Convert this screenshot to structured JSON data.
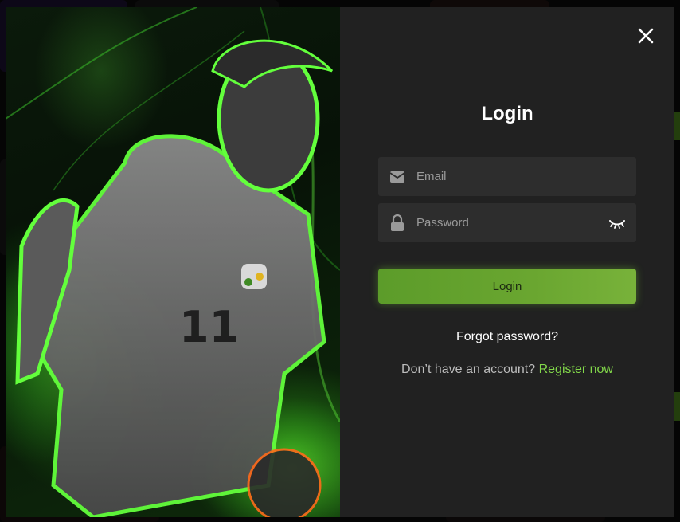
{
  "login": {
    "title": "Login",
    "email_placeholder": "Email",
    "password_placeholder": "Password",
    "submit_label": "Login",
    "forgot_label": "Forgot password?",
    "no_account_text": "Don’t have an account? ",
    "register_label": "Register now"
  },
  "icons": {
    "close": "close-icon",
    "email": "envelope-icon",
    "password": "lock-icon",
    "toggle": "eye-closed-icon"
  },
  "colors": {
    "accent": "#78b23a",
    "link": "#82d84a",
    "panel": "#212121",
    "field": "#2d2d2d"
  }
}
